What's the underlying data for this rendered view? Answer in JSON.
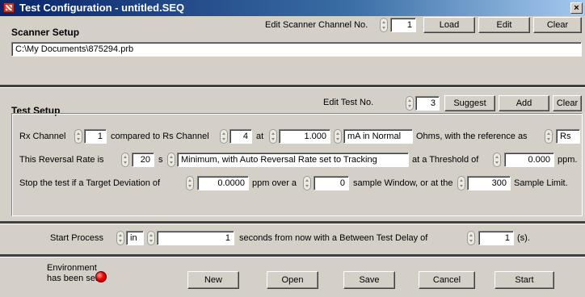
{
  "window": {
    "title": "Test Configuration - untitled.SEQ",
    "close_glyph": "×"
  },
  "scanner": {
    "header": "Scanner Setup",
    "channel_label": "Edit Scanner Channel No.",
    "channel_value": "1",
    "load": "Load",
    "edit": "Edit",
    "clear": "Clear",
    "path": "C:\\My Documents\\875294.prb"
  },
  "test": {
    "header": "Test Setup",
    "test_label": "Edit Test No.",
    "test_value": "3",
    "suggest": "Suggest",
    "add": "Add",
    "clear": "Clear",
    "row1": {
      "rx_label": "Rx Channel",
      "rx_value": "1",
      "compared_label": "compared to Rs Channel",
      "rs_value": "4",
      "at_label": "at",
      "current_value": "1.000",
      "mode_value": "mA in Normal",
      "ohms_label": "Ohms, with the reference as",
      "ref_value": "Rs"
    },
    "row2": {
      "rate_label": "This Reversal Rate is",
      "rate_value": "20",
      "s_label": "s",
      "mode_value": "Minimum, with Auto Reversal Rate set to Tracking",
      "threshold_label": "at a Threshold of",
      "threshold_value": "0.000",
      "ppm_label": "ppm."
    },
    "row3": {
      "stop_label": "Stop the test if a Target Deviation of",
      "deviation_value": "0.0000",
      "over_label": "ppm over a",
      "window_value": "0",
      "window_label": "sample Window, or at the",
      "limit_value": "300",
      "limit_label": "Sample Limit."
    }
  },
  "process": {
    "start_label": "Start Process",
    "in_value": "in",
    "seconds_value": "1",
    "seconds_label": "seconds from now with a  Between Test Delay of",
    "delay_value": "1",
    "delay_unit": "(s)."
  },
  "footer": {
    "env_line1": "Environment",
    "env_line2": "has been set",
    "led_color": "#e00000",
    "new": "New",
    "open": "Open",
    "save": "Save",
    "cancel": "Cancel",
    "start": "Start"
  }
}
